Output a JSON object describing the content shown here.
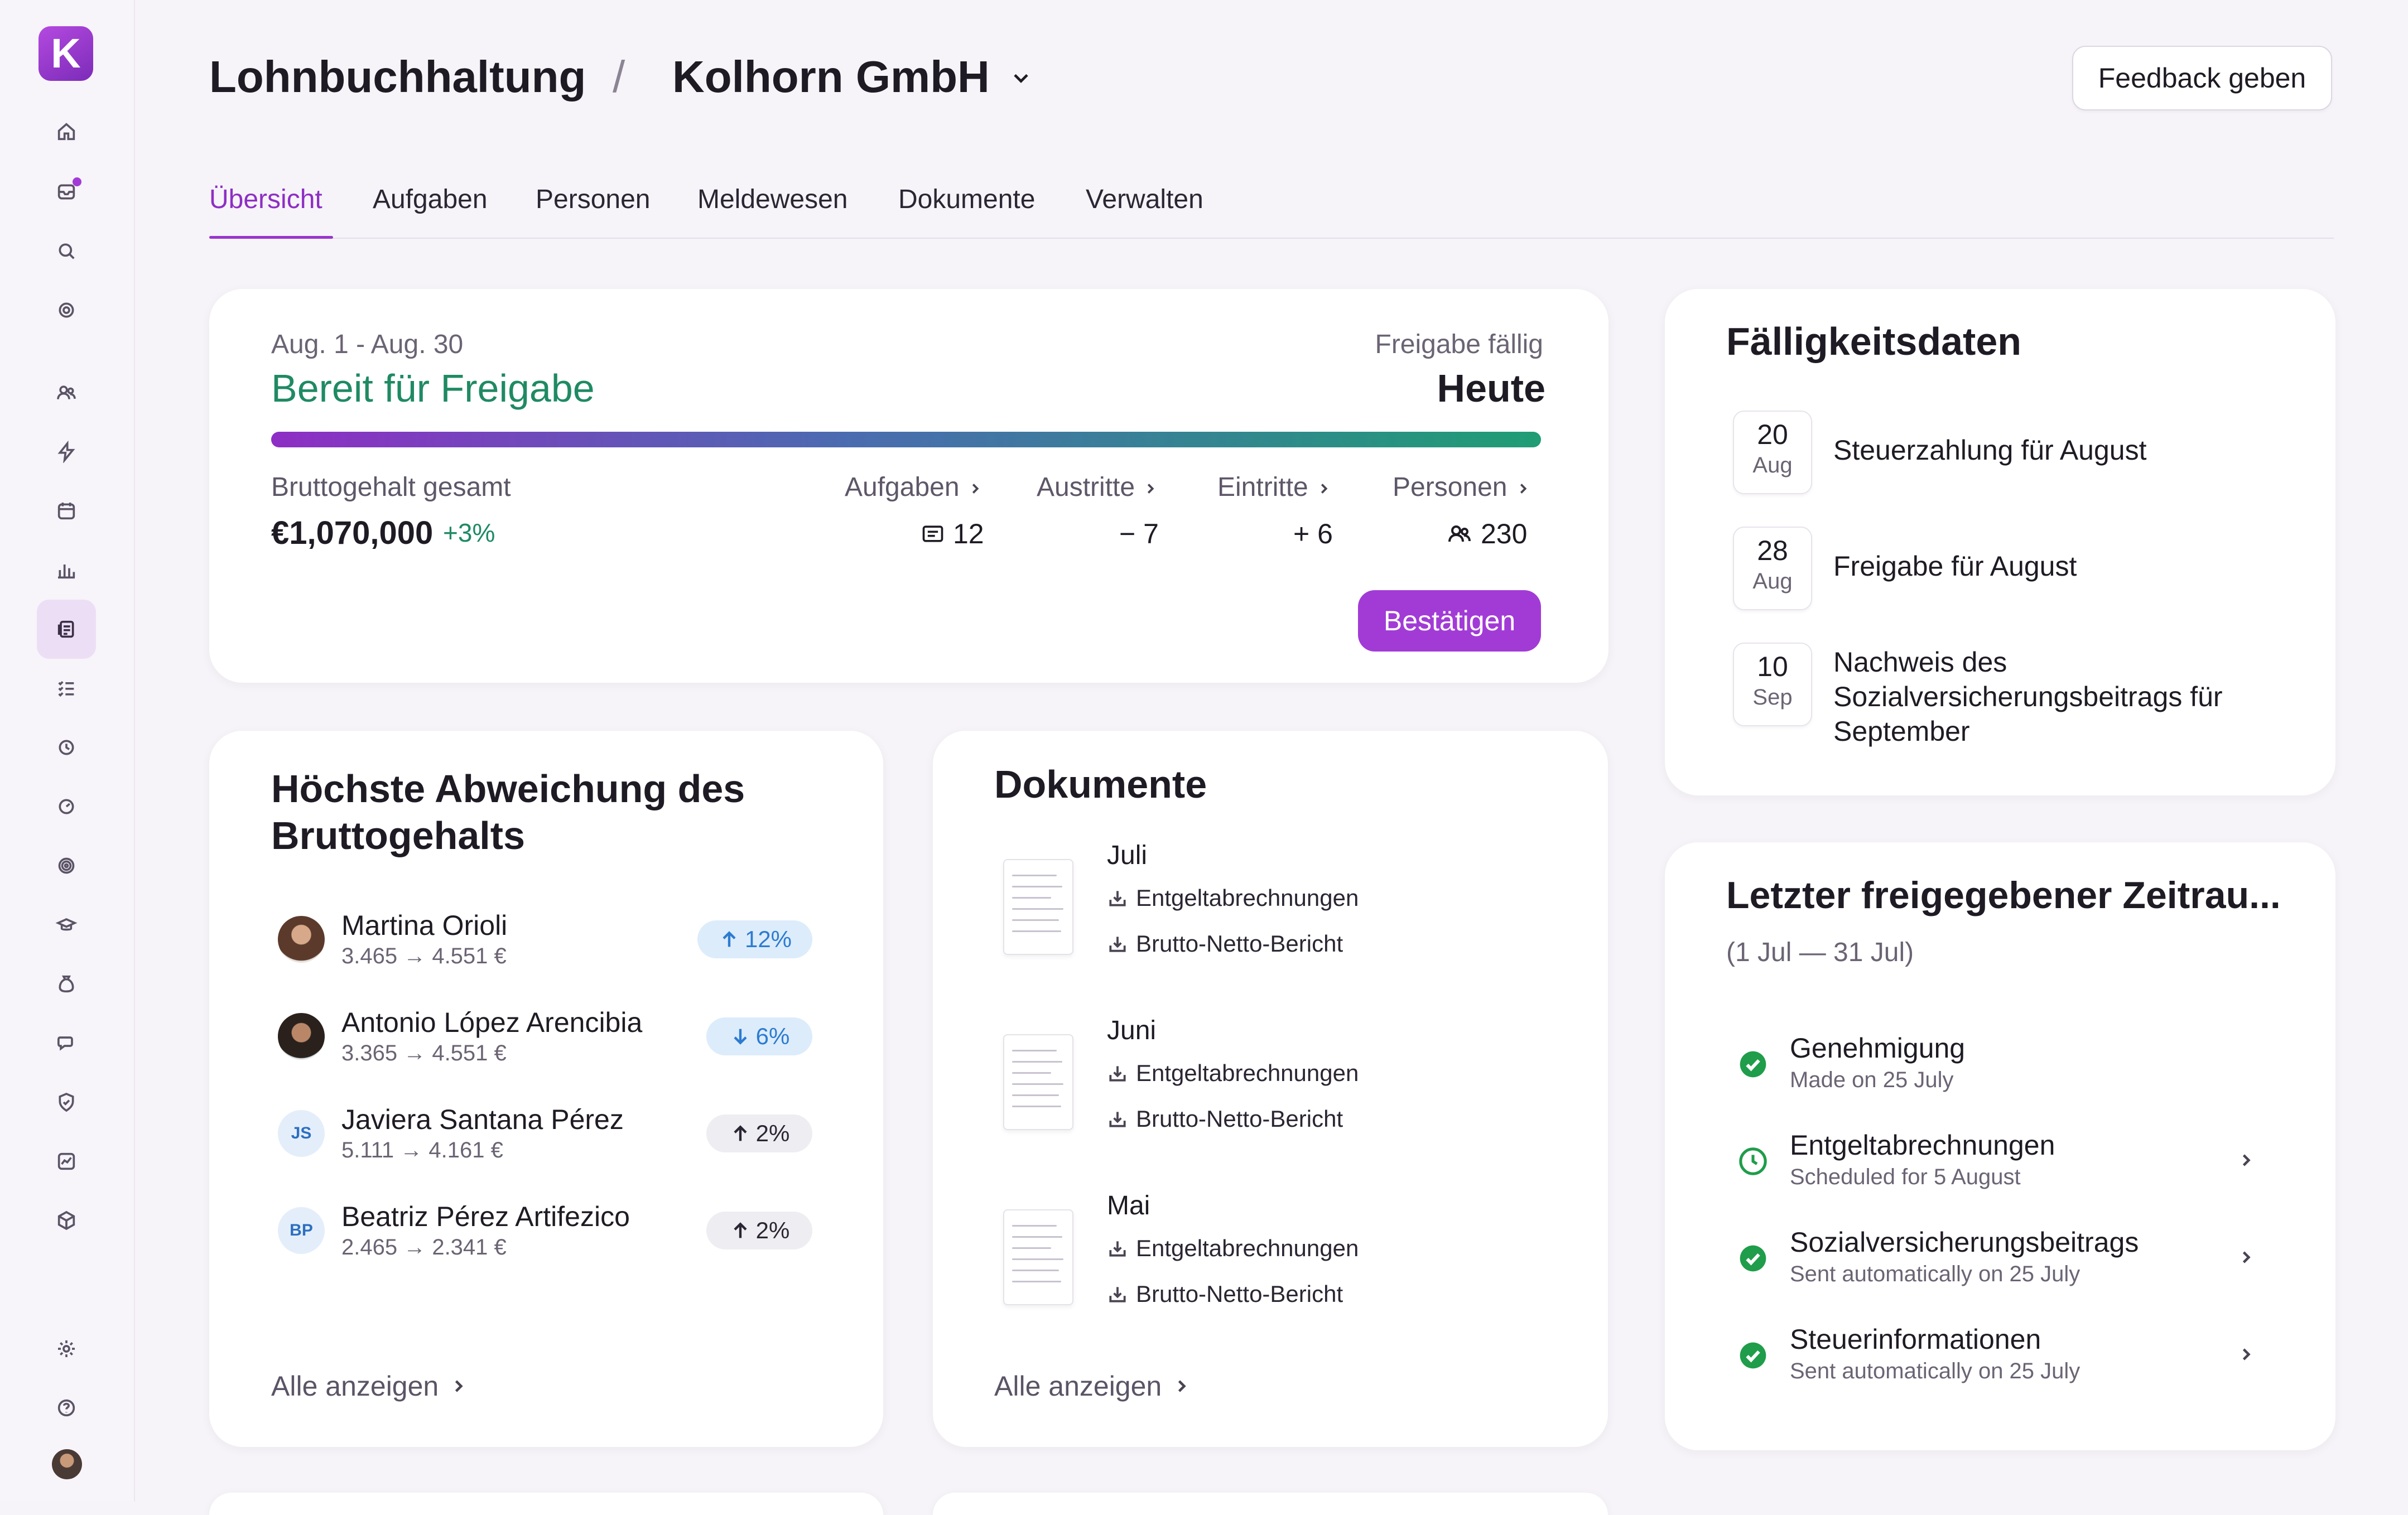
{
  "app": {
    "logo_letter": "K"
  },
  "sidebar": {
    "icons": [
      "home-icon",
      "inbox-icon",
      "search-icon",
      "support-icon",
      "people-icon",
      "lightning-icon",
      "calendar-icon",
      "chart-icon",
      "payroll-icon",
      "checklist-icon",
      "time-icon",
      "speedometer-icon",
      "target-icon",
      "academy-icon",
      "money-bag-icon",
      "chat-icon",
      "shield-icon",
      "analytics-icon",
      "package-icon",
      "settings-icon",
      "help-icon",
      "user-avatar"
    ]
  },
  "header": {
    "section": "Lohnbuchhaltung",
    "separator": "/",
    "company": "Kolhorn GmbH",
    "feedback_label": "Feedback geben"
  },
  "tabs": [
    "Übersicht",
    "Aufgaben",
    "Personen",
    "Meldewesen",
    "Dokumente",
    "Verwalten"
  ],
  "summary": {
    "period": "Aug. 1 - Aug. 30",
    "status": "Bereit für Freigabe",
    "due_label": "Freigabe fällig",
    "due_value": "Heute",
    "gross_label": "Bruttogehalt gesamt",
    "gross_value": "€1,070,000",
    "gross_change": "+3%",
    "stats": [
      {
        "label": "Aufgaben",
        "value": "12",
        "prefix_icon": "list-icon"
      },
      {
        "label": "Austritte",
        "value": "− 7"
      },
      {
        "label": "Eintritte",
        "value": "+ 6"
      },
      {
        "label": "Personen",
        "value": "230",
        "prefix_icon": "people-icon"
      }
    ],
    "confirm_label": "Bestätigen",
    "accent": "#a23bd6",
    "status_color": "#1f8a63"
  },
  "deviation": {
    "title_line1": "Höchste Abweichung des",
    "title_line2": "Bruttogehalts",
    "rows": [
      {
        "name": "Martina Orioli",
        "range": "3.465 → 4.551 €",
        "change": "12%",
        "direction": "up",
        "initials": ""
      },
      {
        "name": "Antonio López Arencibia",
        "range": "3.365 → 4.551 €",
        "change": "6%",
        "direction": "down",
        "initials": ""
      },
      {
        "name": "Javiera Santana Pérez",
        "range": "5.111 → 4.161 €",
        "change": "2%",
        "direction": "up",
        "initials": "JS"
      },
      {
        "name": "Beatriz Pérez Artifezico",
        "range": "2.465 → 2.341 €",
        "change": "2%",
        "direction": "up",
        "initials": "BP"
      }
    ],
    "see_all": "Alle anzeigen"
  },
  "documents": {
    "title": "Dokumente",
    "items": [
      {
        "month": "Juli",
        "links": [
          "Entgeltabrechnungen",
          "Brutto-Netto-Bericht"
        ]
      },
      {
        "month": "Juni",
        "links": [
          "Entgeltabrechnungen",
          "Brutto-Netto-Bericht"
        ]
      },
      {
        "month": "Mai",
        "links": [
          "Entgeltabrechnungen",
          "Brutto-Netto-Bericht"
        ]
      }
    ],
    "see_all": "Alle anzeigen"
  },
  "due_dates": {
    "title": "Fälligkeitsdaten",
    "items": [
      {
        "day": "20",
        "month": "Aug",
        "line1": "Steuerzahlung für August",
        "line2": "",
        "line3": ""
      },
      {
        "day": "28",
        "month": "Aug",
        "line1": "Freigabe für August",
        "line2": "",
        "line3": ""
      },
      {
        "day": "10",
        "month": "Sep",
        "line1": "Nachweis des",
        "line2": "Sozialversicherungsbeitrags für",
        "line3": "September"
      }
    ]
  },
  "last_period": {
    "title": "Letzter freigegebener Zeitrau...",
    "subtitle": "(1 Jul — 31 Jul)",
    "items": [
      {
        "title": "Genehmigung",
        "sub": "Made on 25 July",
        "status": "done",
        "chevron": false
      },
      {
        "title": "Entgeltabrechnungen",
        "sub": "Scheduled for 5 August",
        "status": "scheduled",
        "chevron": true
      },
      {
        "title": "Sozialversicherungsbeitrags",
        "sub": "Sent automatically on 25 July",
        "status": "done",
        "chevron": true
      },
      {
        "title": "Steuerinformationen",
        "sub": "Sent automatically on 25 July",
        "status": "done",
        "chevron": true
      }
    ],
    "done_color": "#1f9d4a"
  }
}
